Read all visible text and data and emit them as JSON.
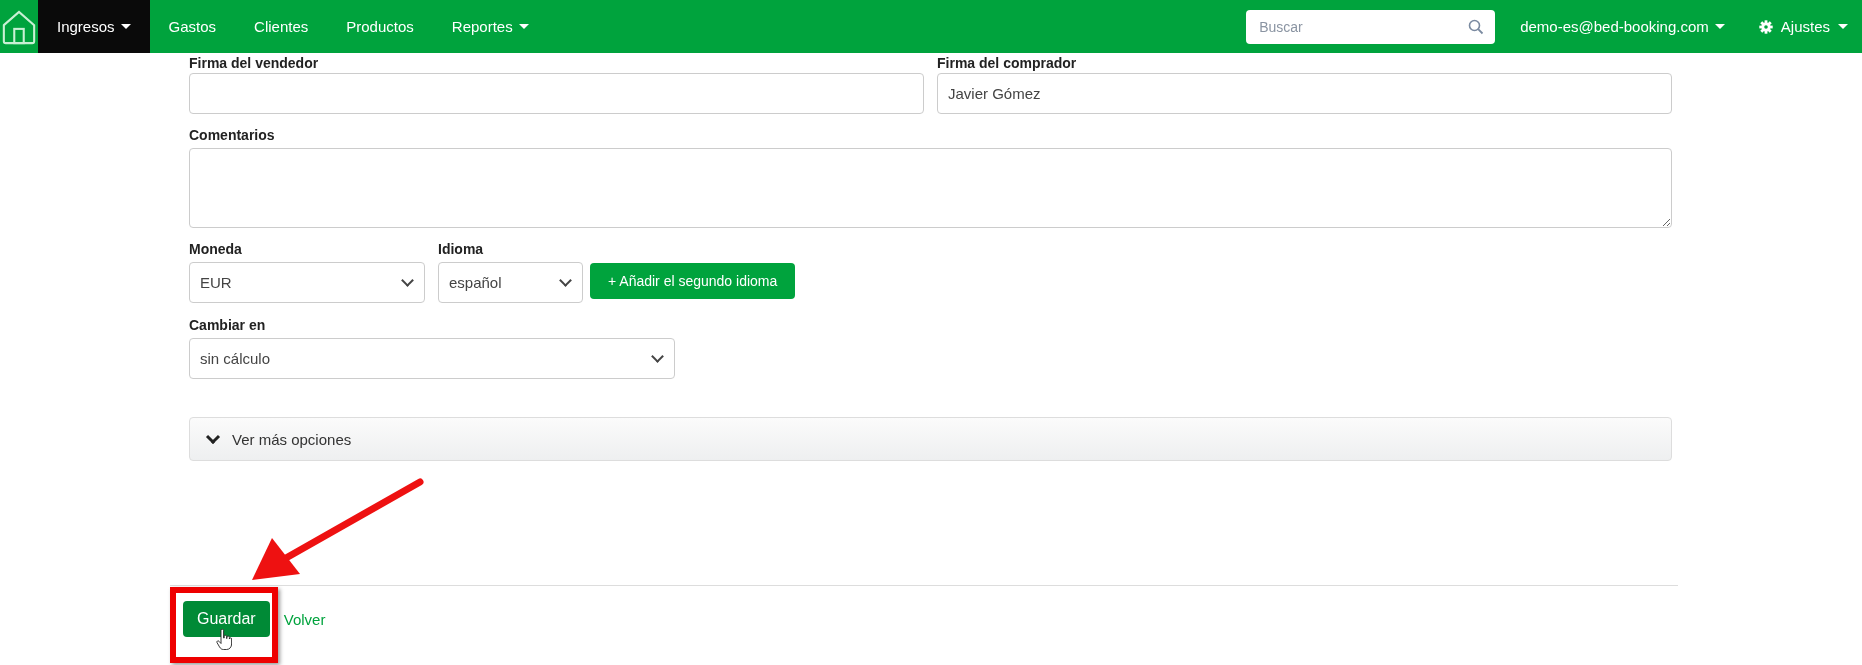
{
  "navbar": {
    "items": [
      {
        "label": "Ingresos",
        "selected": true,
        "dropdown": true
      },
      {
        "label": "Gastos",
        "selected": false,
        "dropdown": false
      },
      {
        "label": "Clientes",
        "selected": false,
        "dropdown": false
      },
      {
        "label": "Productos",
        "selected": false,
        "dropdown": false
      },
      {
        "label": "Reportes",
        "selected": false,
        "dropdown": true
      }
    ],
    "search": {
      "placeholder": "Buscar"
    },
    "user": "demo-es@bed-booking.com",
    "settings": "Ajustes"
  },
  "form": {
    "seller_signature": {
      "label": "Firma del vendedor"
    },
    "buyer_signature": {
      "label": "Firma del comprador",
      "value": "Javier Gómez"
    },
    "comments": {
      "label": "Comentarios"
    },
    "currency": {
      "label": "Moneda",
      "value": "EUR"
    },
    "language": {
      "label": "Idioma",
      "value": "español"
    },
    "add_language_button": "+ Añadir el segundo idioma",
    "exchange": {
      "label": "Cambiar en",
      "value": "sin cálculo"
    },
    "more_options": {
      "label": "Ver más opciones",
      "expanded": false
    }
  },
  "footer": {
    "save_button": "Guardar",
    "back_link": "Volver"
  }
}
